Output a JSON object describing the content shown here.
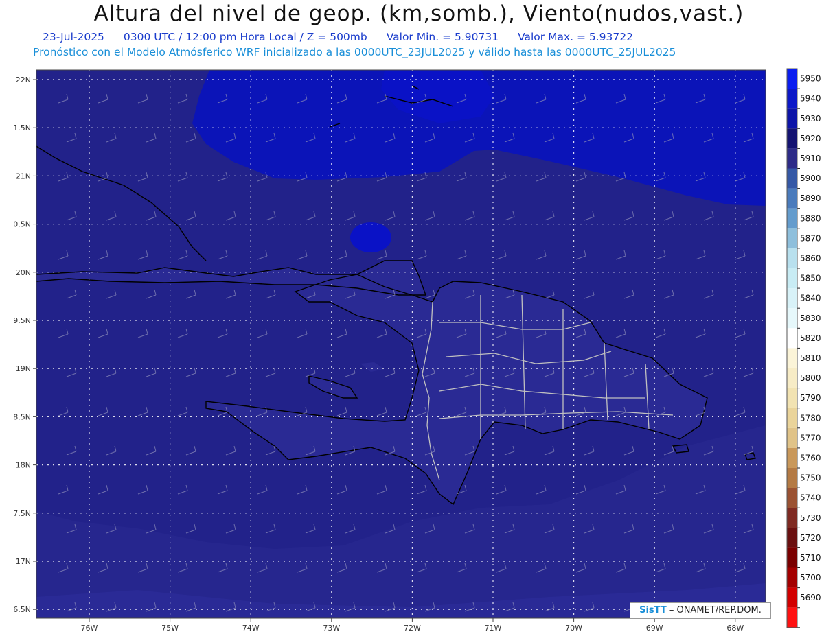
{
  "header": {
    "title": "Altura del nivel de geop. (km,somb.), Viento(nudos,vast.)",
    "date": "23-Jul-2025",
    "time_info": "0300 UTC / 12:00 pm Hora Local / Z = 500mb",
    "min_value": "Valor Min. = 5.90731",
    "max_value": "Valor Max. = 5.93722",
    "model_info": "Pronóstico con el Modelo Atmósferico WRF inicializado a las 0000UTC_23JUL2025 y válido hasta las  0000UTC_25JUL2025"
  },
  "map": {
    "lon_labels": [
      "76W",
      "75W",
      "74W",
      "73W",
      "72W",
      "71W",
      "70W",
      "69W",
      "68W"
    ],
    "lat_labels": [
      "22N",
      "1.5N",
      "21N",
      "0.5N",
      "20N",
      "9.5N",
      "19N",
      "8.5N",
      "18N",
      "7.5N",
      "17N",
      "6.5N"
    ],
    "ocean_colors": [
      "#22228a",
      "#26268e",
      "#2a2a96",
      "#0b14b8",
      "#0a12c6"
    ],
    "land_color": "#2a2a94",
    "grid_color": "#ffffff",
    "coast_color": "#000000",
    "border_color": "#c0c0c0"
  },
  "colorbar": {
    "levels": [
      {
        "label": "5950",
        "color": "#0a1df0"
      },
      {
        "label": "5940",
        "color": "#0c18c8"
      },
      {
        "label": "5930",
        "color": "#0d14a8"
      },
      {
        "label": "5920",
        "color": "#141372"
      },
      {
        "label": "5910",
        "color": "#2d2b88"
      },
      {
        "label": "5900",
        "color": "#3558a6"
      },
      {
        "label": "5890",
        "color": "#4a7bbc"
      },
      {
        "label": "5880",
        "color": "#649ccd"
      },
      {
        "label": "5870",
        "color": "#8ebfdc"
      },
      {
        "label": "5860",
        "color": "#b8e0ee"
      },
      {
        "label": "5850",
        "color": "#c8ecf4"
      },
      {
        "label": "5840",
        "color": "#d8f2f8"
      },
      {
        "label": "5830",
        "color": "#e6f8fb"
      },
      {
        "label": "5820",
        "color": "#ffffff"
      },
      {
        "label": "5810",
        "color": "#fbf4d8"
      },
      {
        "label": "5800",
        "color": "#f7ecc6"
      },
      {
        "label": "5790",
        "color": "#f2e3b2"
      },
      {
        "label": "5780",
        "color": "#ead49a"
      },
      {
        "label": "5770",
        "color": "#e0c388"
      },
      {
        "label": "5760",
        "color": "#c9985a"
      },
      {
        "label": "5750",
        "color": "#b47a44"
      },
      {
        "label": "5740",
        "color": "#9b5232"
      },
      {
        "label": "5730",
        "color": "#7f2a22"
      },
      {
        "label": "5720",
        "color": "#6a1010"
      },
      {
        "label": "5710",
        "color": "#7a0000"
      },
      {
        "label": "5700",
        "color": "#a40000"
      },
      {
        "label": "5690",
        "color": "#d20000"
      },
      {
        "label": "",
        "color": "#ff1111"
      }
    ]
  },
  "footer": {
    "brand": "SisTT",
    "agency": "– ONAMET/REP.DOM."
  }
}
